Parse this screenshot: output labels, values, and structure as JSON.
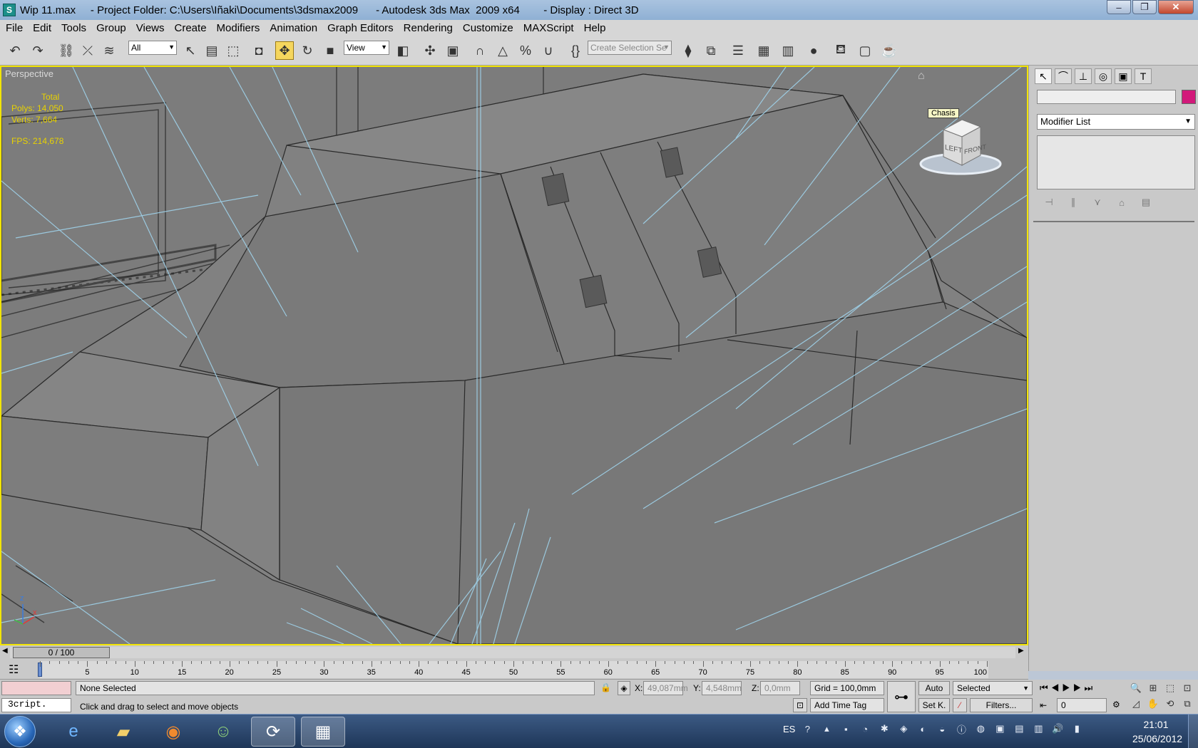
{
  "window": {
    "title": "Wip 11.max     - Project Folder: C:\\Users\\Iñaki\\Documents\\3dsmax2009      - Autodesk 3ds Max  2009 x64        - Display : Direct 3D",
    "app_icon": "3dsmax-icon",
    "minimize_glyph": "–",
    "maximize_glyph": "❐",
    "close_glyph": "✕"
  },
  "menu": [
    "File",
    "Edit",
    "Tools",
    "Group",
    "Views",
    "Create",
    "Modifiers",
    "Animation",
    "Graph Editors",
    "Rendering",
    "Customize",
    "MAXScript",
    "Help"
  ],
  "toolbar": {
    "selection_filter": "All",
    "reference_coord": "View",
    "named_selection_placeholder": "Create Selection Se",
    "icons": [
      "undo-icon",
      "redo-icon",
      "select-link-icon",
      "unlink-icon",
      "bind-spacewarp-icon",
      "select-object-icon",
      "select-by-name-icon",
      "rect-region-icon",
      "window-crossing-icon",
      "move-icon",
      "rotate-icon",
      "scale-icon",
      "pivot-icon",
      "manipulate-icon",
      "keyboard-shortcut-icon",
      "snap-3d-icon",
      "angle-snap-icon",
      "percent-snap-icon",
      "spinner-snap-icon",
      "edit-named-sel-icon",
      "mirror-icon",
      "align-icon",
      "layer-manager-icon",
      "curve-editor-icon",
      "schematic-view-icon",
      "material-editor-icon",
      "render-setup-icon",
      "rendered-frame-icon",
      "render-teapot-icon"
    ]
  },
  "viewport": {
    "label": "Perspective",
    "stats": {
      "total_label": "Total",
      "polys": "Polys: 14,050",
      "verts": "Verts: 7,664",
      "fps": "FPS:   214,678"
    },
    "viewcube_tooltip": "Chasis",
    "viewcube_left": "LEFT",
    "viewcube_front": "FRONT",
    "axis_x": "x",
    "axis_z": "z"
  },
  "command_panel": {
    "tabs": [
      "create-tab",
      "modify-tab",
      "hierarchy-tab",
      "motion-tab",
      "display-tab",
      "utilities-tab"
    ],
    "object_name": "",
    "object_color": "#d2197a",
    "modifier_list": "Modifier List"
  },
  "timeline": {
    "frame_display": "0 / 100",
    "ticks": [
      "5",
      "10",
      "15",
      "20",
      "25",
      "30",
      "35",
      "40",
      "45",
      "50",
      "55",
      "60",
      "65",
      "70",
      "75",
      "80",
      "85",
      "90",
      "95",
      "100"
    ]
  },
  "status": {
    "selection": "None Selected",
    "prompt": "Click and drag to select and move objects",
    "script_listener": "3cript.",
    "x_label": "X:",
    "x_value": "49,087mm",
    "y_label": "Y:",
    "y_value": "4,548mm",
    "z_label": "Z:",
    "z_value": "0,0mm",
    "grid": "Grid = 100,0mm",
    "add_time_tag": "Add Time Tag",
    "auto_key": "Auto",
    "set_key": "Set K.",
    "key_filter": "Selected",
    "filters": "Filters...",
    "current_frame": "0"
  },
  "taskbar": {
    "apps": [
      "internet-explorer-icon",
      "explorer-folder-icon",
      "firefox-icon",
      "people-app-icon",
      "3dsmax-icon",
      "calendar-app-icon"
    ],
    "language": "ES",
    "time": "21:01",
    "date": "25/06/2012"
  }
}
